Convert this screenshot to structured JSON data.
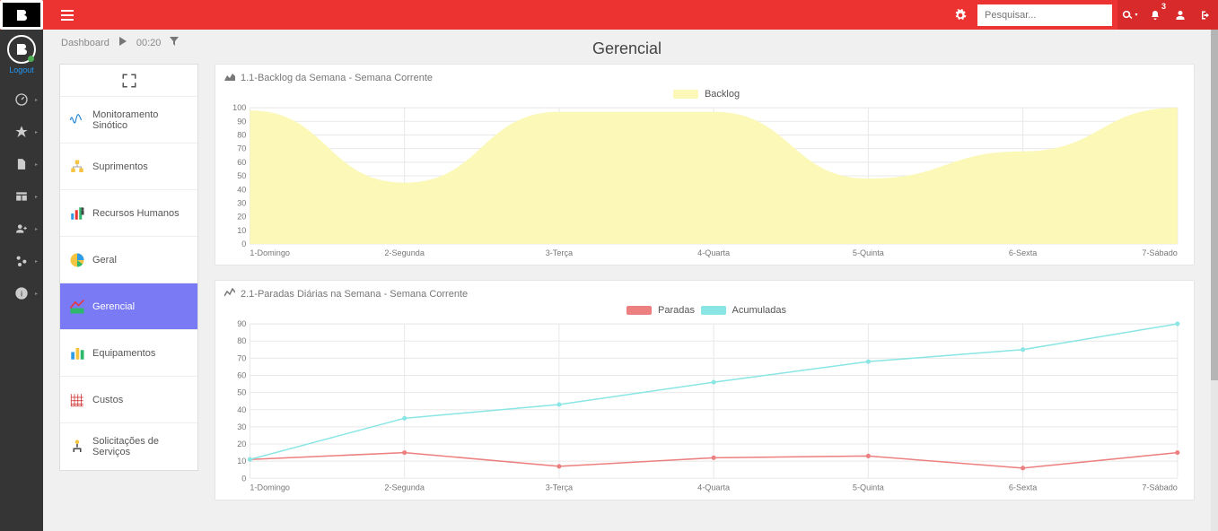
{
  "topbar": {
    "search_placeholder": "Pesquisar...",
    "notif_count": "3"
  },
  "rail": {
    "logout": "Logout"
  },
  "crumbs": {
    "dashboard": "Dashboard",
    "time": "00:20"
  },
  "page_title": "Gerencial",
  "panel": {
    "items": [
      {
        "label": "Monitoramento Sinótico"
      },
      {
        "label": "Suprimentos"
      },
      {
        "label": "Recursos Humanos"
      },
      {
        "label": "Geral"
      },
      {
        "label": "Gerencial",
        "active": true
      },
      {
        "label": "Equipamentos"
      },
      {
        "label": "Custos"
      },
      {
        "label": "Solicitações de Serviços"
      }
    ]
  },
  "cards": {
    "backlog": {
      "title": "1.1-Backlog da Semana - Semana Corrente",
      "legend": "Backlog"
    },
    "paradas": {
      "title": "2.1-Paradas Diárias na Semana - Semana Corrente",
      "legend1": "Paradas",
      "legend2": "Acumuladas"
    }
  },
  "xcats": [
    "1-Domingo",
    "2-Segunda",
    "3-Terça",
    "4-Quarta",
    "5-Quinta",
    "6-Sexta",
    "7-Sábado"
  ],
  "chart_data": [
    {
      "type": "area",
      "title": "1.1-Backlog da Semana - Semana Corrente",
      "categories": [
        "1-Domingo",
        "2-Segunda",
        "3-Terça",
        "4-Quarta",
        "5-Quinta",
        "6-Sexta",
        "7-Sábado"
      ],
      "series": [
        {
          "name": "Backlog",
          "values": [
            98,
            45,
            97,
            97,
            48,
            68,
            100
          ],
          "color": "#fbf8b8"
        }
      ],
      "ylim": [
        0,
        100
      ],
      "yticks": [
        0,
        10,
        20,
        30,
        40,
        50,
        60,
        70,
        80,
        90,
        100
      ],
      "xlabel": "",
      "ylabel": ""
    },
    {
      "type": "line",
      "title": "2.1-Paradas Diárias na Semana - Semana Corrente",
      "categories": [
        "1-Domingo",
        "2-Segunda",
        "3-Terça",
        "4-Quarta",
        "5-Quinta",
        "6-Sexta",
        "7-Sábado"
      ],
      "series": [
        {
          "name": "Paradas",
          "values": [
            11,
            15,
            7,
            12,
            13,
            6,
            15
          ],
          "color": "#ec7f7f"
        },
        {
          "name": "Acumuladas",
          "values": [
            11,
            35,
            43,
            56,
            68,
            75,
            90
          ],
          "color": "#8ae5e5"
        }
      ],
      "ylim": [
        0,
        90
      ],
      "yticks": [
        0,
        10,
        20,
        30,
        40,
        50,
        60,
        70,
        80,
        90
      ],
      "xlabel": "",
      "ylabel": ""
    }
  ]
}
